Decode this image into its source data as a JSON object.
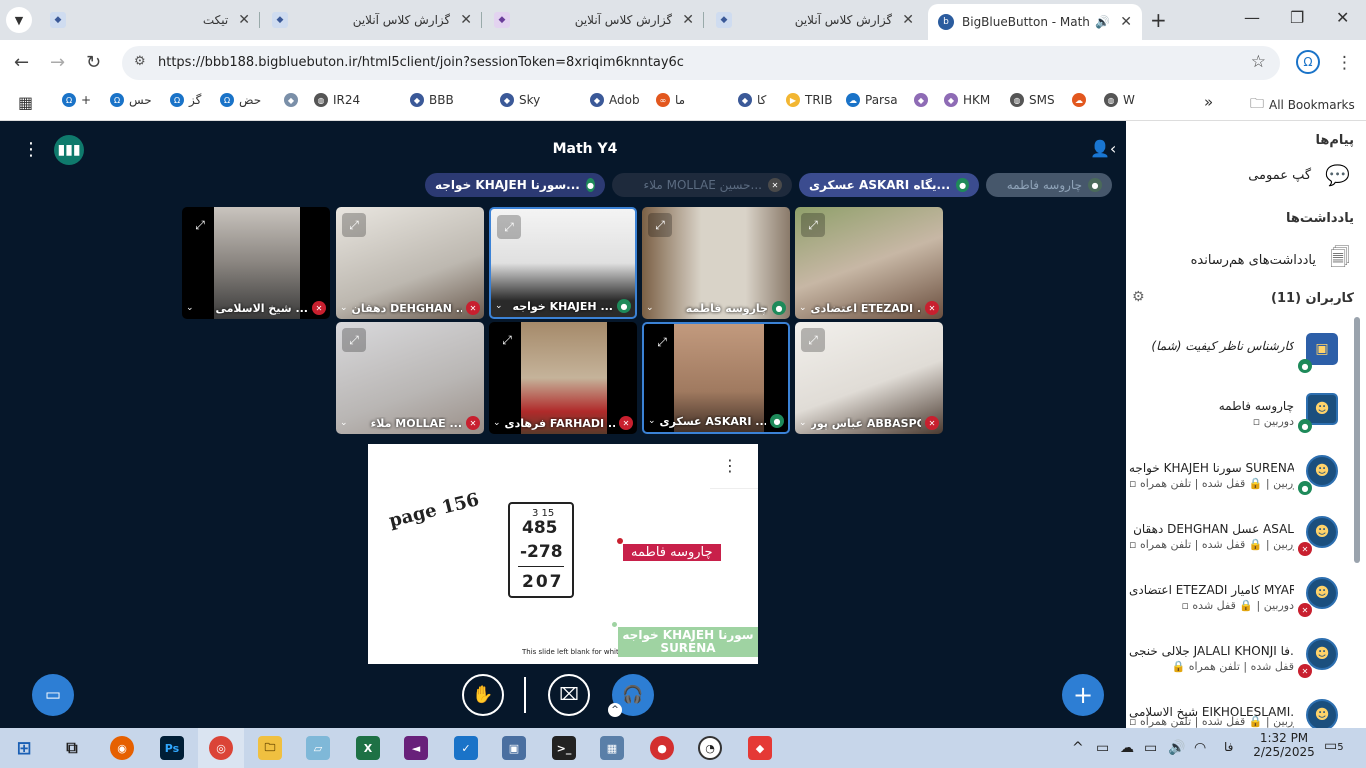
{
  "browser": {
    "tabs": [
      {
        "title": "تیکت"
      },
      {
        "title": "گزارش کلاس آنلاین"
      },
      {
        "title": "گزارش کلاس آنلاین"
      },
      {
        "title": "گزارش کلاس آنلاین"
      },
      {
        "title": "BigBlueButton - Math Y4"
      }
    ],
    "url": "https://bbb188.bigbluebuton.ir/html5client/join?sessionToken=8xriqim6knntay6c",
    "bookmarks": [
      "+",
      "حس",
      "گز",
      "حض",
      "IR24",
      "BBB",
      "Sky",
      "Adob",
      "ما",
      "کا",
      "TRIB",
      "Parsa",
      "HKM",
      "SMS",
      "W"
    ],
    "all_bookmarks": "All Bookmarks"
  },
  "meeting": {
    "title": "Math Y4",
    "talkers": [
      {
        "name": "چاروسه فاطمه",
        "color": "#46576b",
        "text": "#8fa3b8",
        "mic": "#4a6a5a"
      },
      {
        "name": "عسکری ASKARI یگاه...",
        "color": "#3b4c8f",
        "text": "#ffffff",
        "mic": "#1e8a5a"
      },
      {
        "name": "ملاء MOLLAE حسین...",
        "color": "#1e2a3c",
        "text": "#5b6b80",
        "mic": "#4a4a4a"
      },
      {
        "name": "خواجه KHAJEH سورنا...",
        "color": "#2c3a73",
        "text": "#ffffff",
        "mic": "#1e8a5a"
      }
    ],
    "videos": [
      {
        "name": "شیخ الاسلامی ...",
        "state": "muted"
      },
      {
        "name": "دهقان DEHGHAN ...",
        "state": "muted"
      },
      {
        "name": "خواجه KHAJEH ...",
        "state": "talk"
      },
      {
        "name": "چاروسه فاطمه",
        "state": "on"
      },
      {
        "name": "اعتضادی ETEZADI ...",
        "state": "muted"
      },
      {
        "name": "ملاء MOLLAE ...",
        "state": "muted"
      },
      {
        "name": "فرهادی FARHADI ...",
        "state": "muted"
      },
      {
        "name": "عسکری ASKARI ...",
        "state": "talk"
      },
      {
        "name": "عباس پور ABBASPOUR ...",
        "state": "muted"
      }
    ],
    "slide": {
      "page_text": "page 156",
      "math_lines": [
        "485",
        "-278",
        "207"
      ],
      "math_carry": "3 15",
      "cursor_label_1": "چاروسه فاطمه",
      "cursor_label_2": "خواجه KHAJEH سورنا SURENA",
      "footer": "This slide left blank for whiteboard"
    }
  },
  "sidebar": {
    "messages_heading": "پیام‌ها",
    "public_chat": "گپ عمومی",
    "notes_heading": "یادداشت‌ها",
    "shared_notes": "یادداشت‌های هم‌رسانده",
    "users_heading": "کاربران (11)",
    "users": [
      {
        "name": "کارشناس ناظر کیفیت (شما)",
        "status": "",
        "mic": "#1e8a5a",
        "italic": true
      },
      {
        "name": "چاروسه فاطمه",
        "status": "▫ دوربین",
        "mic": "#1e8a5a"
      },
      {
        "name": "خواجه KHAJEH سورنا SURENA",
        "status": "▫ دوربین | 🔒 قفل شده | تلفن همراه",
        "mic": "#1e8a5a"
      },
      {
        "name": "دهقان DEHGHAN عسل ASAL",
        "status": "▫ دوربین | 🔒 قفل شده | تلفن همراه",
        "mic": "#c8202f"
      },
      {
        "name": "اعتضادی ETEZADI کامیار MYAR...",
        "status": "▫ دوربین | 🔒 قفل شده",
        "mic": "#c8202f"
      },
      {
        "name": "جلالی خنجی JALALI KHONJI فا...",
        "status": "🔒 قفل شده | تلفن همراه",
        "mic": "#c8202f"
      },
      {
        "name": "شیخ الاسلامی EIKHOLESLAMI...",
        "status": "▫ دوربین | 🔒 قفل شده | تلفن همراه",
        "mic": "#c8202f"
      }
    ]
  },
  "taskbar": {
    "time": "1:32 PM",
    "date": "2/25/2025",
    "lang": "فا",
    "notif_count": "5"
  }
}
